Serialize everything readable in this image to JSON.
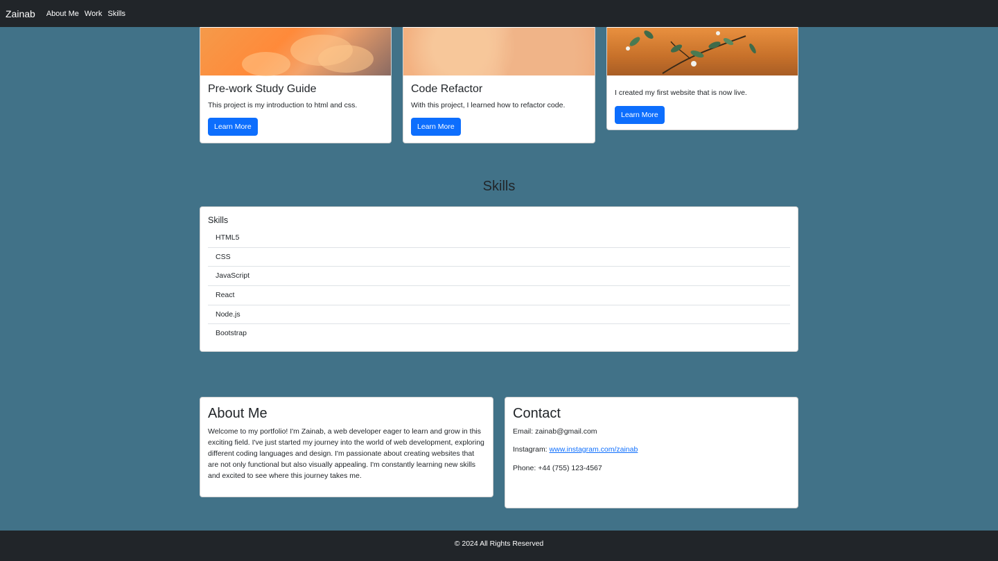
{
  "nav": {
    "brand": "Zainab",
    "links": [
      "About Me",
      "Work",
      "Skills"
    ]
  },
  "projects": [
    {
      "title": "Pre-work Study Guide",
      "text": "This project is my introduction to html and css.",
      "button": "Learn More"
    },
    {
      "title": "Code Refactor",
      "text": "With this project, I learned how to refactor code.",
      "button": "Learn More"
    },
    {
      "title": "",
      "text": "I created my first website that is now live.",
      "button": "Learn More"
    }
  ],
  "skills": {
    "section_title": "Skills",
    "card_header": "Skills",
    "items": [
      "HTML5",
      "CSS",
      "JavaScript",
      "React",
      "Node.js",
      "Bootstrap"
    ]
  },
  "about": {
    "title": "About Me",
    "text": "Welcome to my portfolio! I'm Zainab, a web developer eager to learn and grow in this exciting field. I've just started my journey into the world of web development, exploring different coding languages and design. I'm passionate about creating websites that are not only functional but also visually appealing. I'm constantly learning new skills and excited to see where this journey takes me."
  },
  "contact": {
    "title": "Contact",
    "email_label": "Email: zainab@gmail.com",
    "instagram_label": "Instagram: ",
    "instagram_link": "www.instagram.com/zainab",
    "phone_label": "Phone: +44 (755) 123-4567"
  },
  "footer": {
    "text": "© 2024 All Rights Reserved"
  },
  "colors": {
    "page_bg": "#417288",
    "navbar_bg": "#212529",
    "button_bg": "#0d6efd"
  }
}
